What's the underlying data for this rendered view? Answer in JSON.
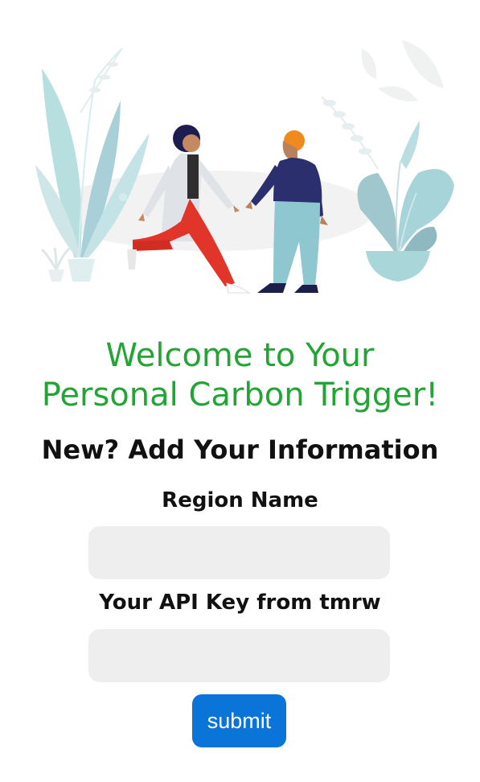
{
  "illustration": {
    "name": "people-greeting-illustration"
  },
  "welcome": {
    "line1": "Welcome to Your",
    "line2": "Personal Carbon Trigger!"
  },
  "subtitle": "New? Add Your Information",
  "form": {
    "region_label": "Region Name",
    "region_value": "",
    "region_placeholder": "",
    "api_label": "Your API Key from tmrw",
    "api_value": "",
    "api_placeholder": "",
    "submit_label": "submit"
  },
  "colors": {
    "title": "#22a534",
    "button": "#0a74d8",
    "field_bg": "#eeeeee"
  }
}
